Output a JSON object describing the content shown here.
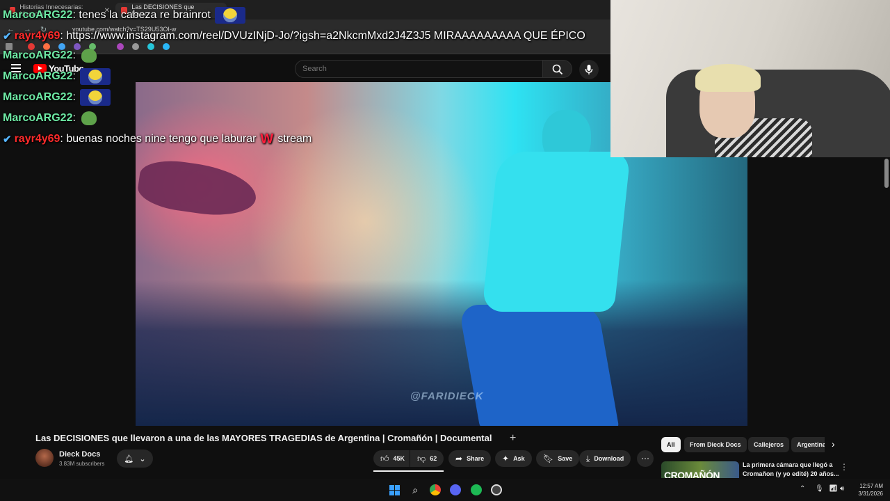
{
  "browser": {
    "tabs": [
      {
        "label": "Historias Innecesarias: Masacre"
      },
      {
        "label": "Las DECISIONES que llevar"
      }
    ],
    "url": "youtube.com/watch?v=TS29U53OI-w"
  },
  "youtube": {
    "logo_text": "YouTube",
    "search_placeholder": "Search"
  },
  "chat": [
    {
      "user": "MarcoARG22",
      "text": "tenes la cabeza re brainrot",
      "emote": "minion"
    },
    {
      "user": "rayr4y69",
      "text": "https://www.instagram.com/reel/DVUzINjD-Jo/?igsh=a2NkcmMxd2J4Z3J5 MIRAAAAAAAAA QUE ÉPICO",
      "badge": true
    },
    {
      "user": "MarcoARG22",
      "text": "",
      "emote": "pepe"
    },
    {
      "user": "MarcoARG22",
      "text": "",
      "emote": "minion"
    },
    {
      "user": "MarcoARG22",
      "text": "",
      "emote": "minion"
    },
    {
      "user": "MarcoARG22",
      "text": "",
      "emote": "pepe"
    },
    {
      "user": "rayr4y69",
      "text": "buenas noches nine tengo que laburar",
      "text_after": "stream",
      "badge": true,
      "w_icon": "W"
    }
  ],
  "video": {
    "watermark": "@FARIDIECK",
    "title": "Las DECISIONES que llevaron a una de las MAYORES TRAGEDIAS de Argentina | Cromañón | Documental",
    "channel": "Dieck Docs",
    "subscribers": "3.83M subscribers",
    "likes": "45K",
    "dislikes": "62",
    "share_label": "Share",
    "ask_label": "Ask",
    "save_label": "Save",
    "download_label": "Download"
  },
  "chips": [
    "All",
    "From Dieck Docs",
    "Callejeros",
    "Argentina"
  ],
  "recommendation": {
    "thumb_text": "CROMAÑÓN",
    "title": "La primera cámara que llegó a Cromañon (y yo edité) 20 años..."
  },
  "taskbar": {
    "time": "12:57 AM",
    "date": "3/31/2026"
  }
}
